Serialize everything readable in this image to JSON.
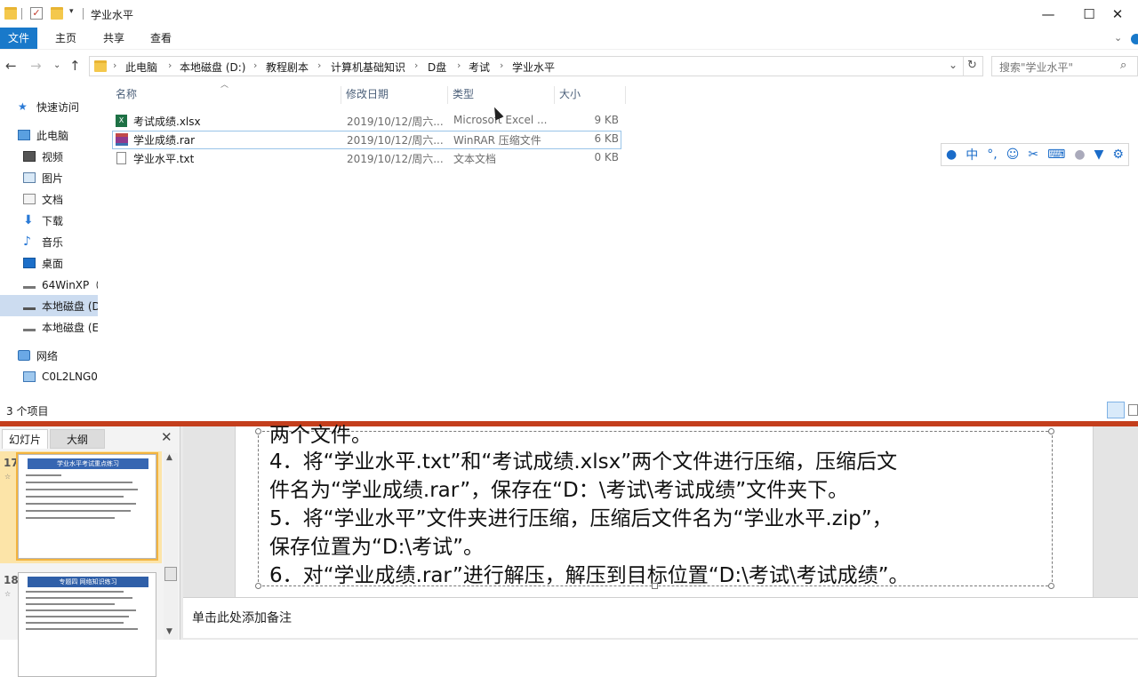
{
  "window": {
    "title": "学业水平"
  },
  "ribbon": {
    "tabs": [
      "文件",
      "主页",
      "共享",
      "查看"
    ]
  },
  "address": {
    "crumbs": [
      "此电脑",
      "本地磁盘 (D:)",
      "教程剧本",
      "计算机基础知识",
      "D盘",
      "考试",
      "学业水平"
    ],
    "search_placeholder": "搜索\"学业水平\""
  },
  "nav": {
    "items": [
      "快速访问",
      "此电脑",
      "视频",
      "图片",
      "文档",
      "下载",
      "音乐",
      "桌面",
      "64WinXP（",
      "本地磁盘 (D",
      "本地磁盘 (E",
      "网络",
      "C0L2LNG0"
    ]
  },
  "columns": {
    "name": "名称",
    "date": "修改日期",
    "type": "类型",
    "size": "大小"
  },
  "files": [
    {
      "name": "考试成绩.xlsx",
      "date": "2019/10/12/周六...",
      "type": "Microsoft Excel ...",
      "size": "9 KB"
    },
    {
      "name": "学业成绩.rar",
      "date": "2019/10/12/周六...",
      "type": "WinRAR 压缩文件",
      "size": "6 KB"
    },
    {
      "name": "学业水平.txt",
      "date": "2019/10/12/周六...",
      "type": "文本文档",
      "size": "0 KB"
    }
  ],
  "status": {
    "count": "3 个项目"
  },
  "ime": {
    "mode": "中"
  },
  "ppt": {
    "tabs": [
      "幻灯片",
      "大纲"
    ],
    "thumbs": [
      {
        "num": "17",
        "title": "学业水平考试重点练习"
      },
      {
        "num": "18",
        "title": "专题四 网络知识练习"
      }
    ],
    "slide_lines": [
      "两个文件。",
      "4．将“学业水平.txt”和“考试成绩.xlsx”两个文件进行压缩，压缩后文",
      "件名为“学业成绩.rar”，保存在“D：\\考试\\考试成绩”文件夹下。",
      "5．将“学业水平”文件夹进行压缩，压缩后文件名为“学业水平.zip”，",
      "保存位置为“D:\\考试”。",
      "6．对“学业成绩.rar”进行解压，解压到目标位置“D:\\考试\\考试成绩”。"
    ],
    "notes_placeholder": "单击此处添加备注"
  }
}
